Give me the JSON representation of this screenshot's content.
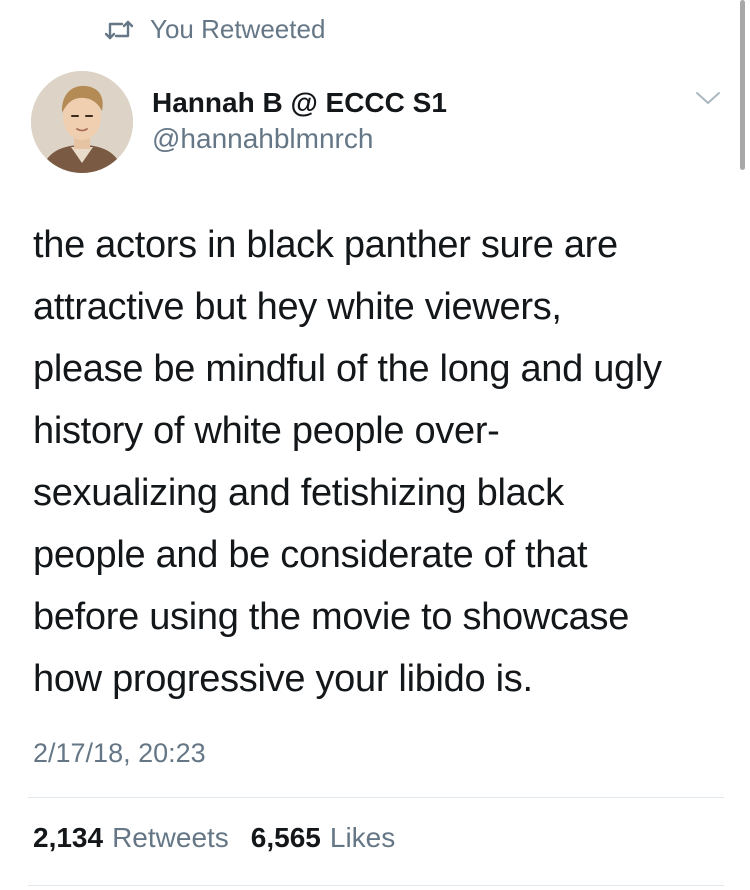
{
  "retweet_context": {
    "icon": "retweet-icon",
    "text": "You Retweeted"
  },
  "author": {
    "display_name": "Hannah B @ ECCC S1",
    "handle": "@hannahblmnrch",
    "avatar": "illustrated-portrait-avatar"
  },
  "tweet": {
    "text": "the actors in black panther sure are\nattractive but hey white viewers,\nplease be mindful of the long and ugly\nhistory of white people over-\nsexualizing and fetishizing black\npeople and be considerate of that\nbefore using the movie to showcase\nhow progressive your libido is.",
    "timestamp": "2/17/18, 20:23"
  },
  "stats": {
    "retweets_count": "2,134",
    "retweets_label": "Retweets",
    "likes_count": "6,565",
    "likes_label": "Likes"
  },
  "colors": {
    "primary_text": "#14171a",
    "secondary_text": "#657786",
    "divider": "#e1e8ed"
  }
}
